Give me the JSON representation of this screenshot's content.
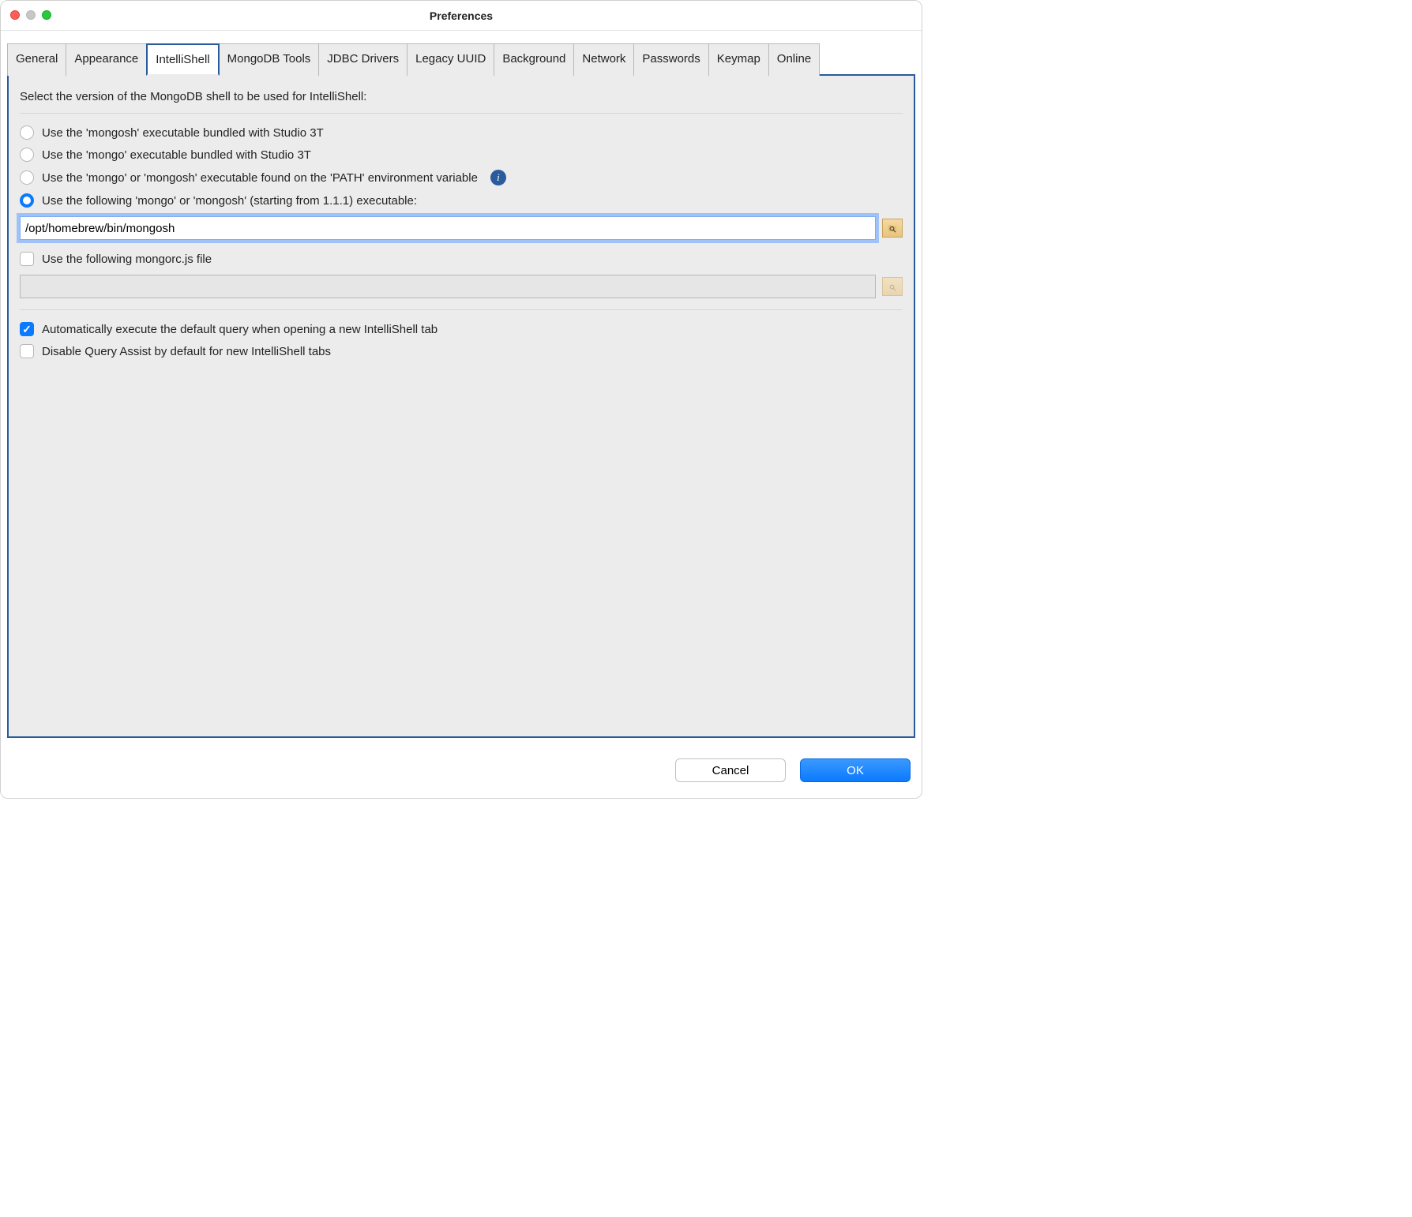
{
  "window": {
    "title": "Preferences"
  },
  "tabs": [
    {
      "label": "General"
    },
    {
      "label": "Appearance"
    },
    {
      "label": "IntelliShell",
      "active": true
    },
    {
      "label": "MongoDB Tools"
    },
    {
      "label": "JDBC Drivers"
    },
    {
      "label": "Legacy UUID"
    },
    {
      "label": "Background"
    },
    {
      "label": "Network"
    },
    {
      "label": "Passwords"
    },
    {
      "label": "Keymap"
    },
    {
      "label": "Online"
    }
  ],
  "intellishell": {
    "section_label": "Select the version of the MongoDB shell to be used for IntelliShell:",
    "radios": {
      "bundled_mongosh": "Use the 'mongosh' executable bundled with Studio 3T",
      "bundled_mongo": "Use the 'mongo' executable bundled with Studio 3T",
      "on_path": "Use the 'mongo' or 'mongosh' executable found on the 'PATH' environment variable",
      "custom": "Use the following 'mongo' or 'mongosh' (starting from 1.1.1) executable:",
      "selected": "custom"
    },
    "custom_path": "/opt/homebrew/bin/mongosh",
    "mongorc": {
      "label": "Use the following mongorc.js file",
      "checked": false,
      "path": ""
    },
    "auto_execute": {
      "label": "Automatically execute the default query when opening a new IntelliShell tab",
      "checked": true
    },
    "disable_assist": {
      "label": "Disable Query Assist by default for new IntelliShell tabs",
      "checked": false
    }
  },
  "footer": {
    "cancel": "Cancel",
    "ok": "OK"
  },
  "icons": {
    "info_glyph": "i"
  }
}
